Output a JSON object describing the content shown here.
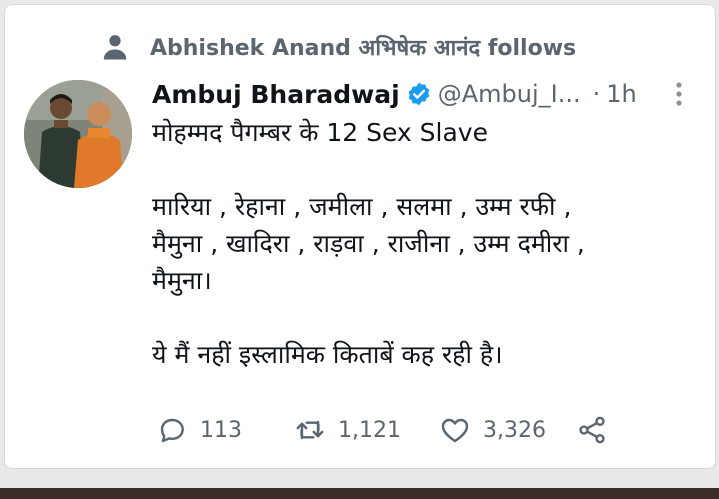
{
  "context": {
    "text": "Abhishek Anand अभिषेक आनंद follows",
    "icon": "person-icon"
  },
  "tweet": {
    "author_name": "Ambuj Bharadwaj",
    "verified": true,
    "handle": "@Ambuj_I...",
    "separator": "·",
    "time": "1h",
    "lines": [
      "मोहम्मद पैगम्बर के 12 Sex Slave",
      "",
      "मारिया , रेहाना , जमीला , सलमा , उम्म रफी ,",
      "मैमुना , खादिरा , राड़वा , राजीना , उम्म दमीरा ,",
      "मैमुना।",
      "",
      "ये मैं नहीं इस्लामिक किताबें कह रही है।"
    ]
  },
  "actions": {
    "replies": "113",
    "retweets": "1,121",
    "likes": "3,326"
  },
  "colors": {
    "text": "#0f1419",
    "secondary": "#5b6570",
    "verified": "#1d9bf0",
    "background": "#ffffff"
  }
}
